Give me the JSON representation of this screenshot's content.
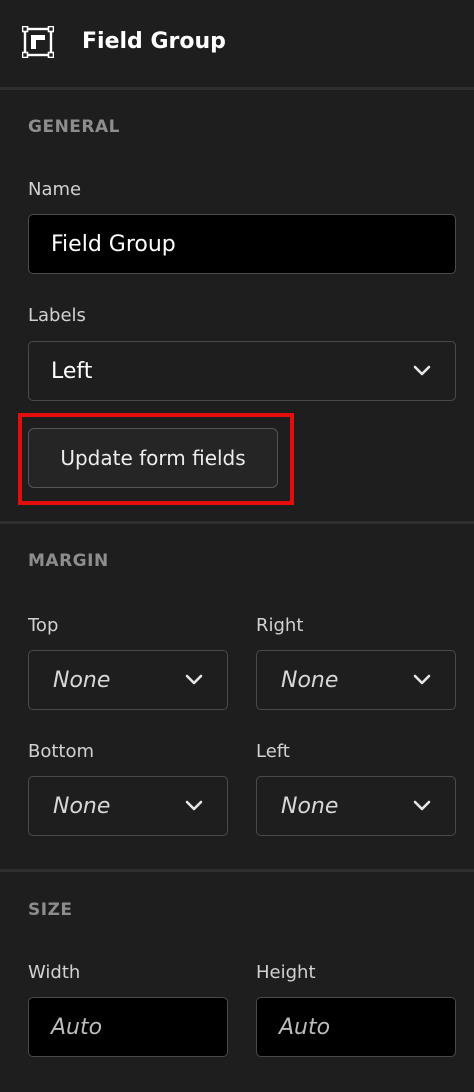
{
  "header": {
    "title": "Field Group",
    "icon": "field-group-icon"
  },
  "general": {
    "section_title": "GENERAL",
    "name_label": "Name",
    "name_value": "Field Group",
    "labels_label": "Labels",
    "labels_value": "Left",
    "update_button_label": "Update form fields"
  },
  "margin": {
    "section_title": "MARGIN",
    "top_label": "Top",
    "top_value": "None",
    "right_label": "Right",
    "right_value": "None",
    "bottom_label": "Bottom",
    "bottom_value": "None",
    "left_label": "Left",
    "left_value": "None"
  },
  "size": {
    "section_title": "SIZE",
    "width_label": "Width",
    "width_placeholder": "Auto",
    "height_label": "Height",
    "height_placeholder": "Auto"
  },
  "colors": {
    "background": "#1e1e1e",
    "input_background": "#000000",
    "border": "#4a4a4a",
    "section_title": "#8d8d8d",
    "highlight": "#e30d0d"
  }
}
